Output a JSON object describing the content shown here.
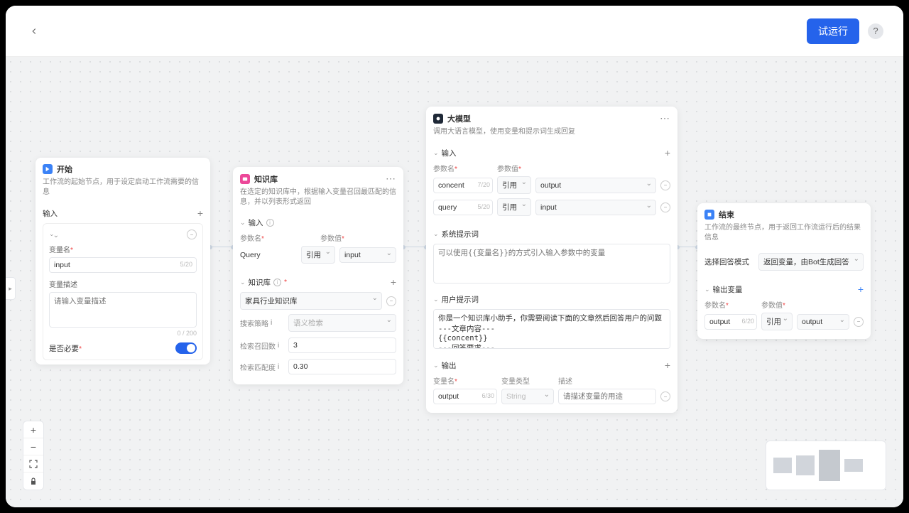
{
  "topbar": {
    "run_button": "试运行"
  },
  "node_start": {
    "title": "开始",
    "desc": "工作流的起始节点，用于设定启动工作流需要的信息",
    "input_section": "输入",
    "var_name_label": "变量名",
    "var_name_value": "input",
    "var_name_count": "5/20",
    "var_desc_label": "变量描述",
    "var_desc_placeholder": "请输入变量描述",
    "var_desc_count": "0 / 200",
    "required_label": "是否必要"
  },
  "node_kb": {
    "title": "知识库",
    "desc": "在选定的知识库中，根据输入变量召回最匹配的信息，并以列表形式返回",
    "input_section": "输入",
    "param_name_col": "参数名",
    "param_value_col": "参数值",
    "param_name": "Query",
    "ref_label": "引用",
    "ref_value": "input",
    "kb_section": "知识库",
    "kb_selected": "家具行业知识库",
    "search_strategy_label": "搜索策略",
    "search_strategy_value": "语义检索",
    "recall_count_label": "检索召回数",
    "recall_count_value": "3",
    "match_threshold_label": "检索匹配度",
    "match_threshold_value": "0.30"
  },
  "node_llm": {
    "title": "大模型",
    "desc": "调用大语言模型，使用变量和提示词生成回复",
    "input_section": "输入",
    "param_name_col": "参数名",
    "param_value_col": "参数值",
    "rows": [
      {
        "name": "concent",
        "count": "7/20",
        "ref": "引用",
        "val": "output"
      },
      {
        "name": "query",
        "count": "5/20",
        "ref": "引用",
        "val": "input"
      }
    ],
    "sys_prompt_section": "系统提示词",
    "sys_prompt_placeholder": "可以使用{{变量名}}的方式引入输入参数中的变量",
    "user_prompt_section": "用户提示词",
    "user_prompt_text": "你是一个知识库小助手，你需要阅读下面的文章然后回答用户的问题\n---文章内容---\n{{concent}}\n---回答要求---",
    "output_section": "输出",
    "out_var_name_col": "变量名",
    "out_var_type_col": "变量类型",
    "out_desc_col": "描述",
    "out_name": "output",
    "out_name_count": "6/30",
    "out_type": "String",
    "out_desc_placeholder": "请描述变量的用途"
  },
  "node_end": {
    "title": "结束",
    "desc": "工作流的最终节点，用于返回工作流运行后的结果信息",
    "answer_mode_label": "选择回答模式",
    "answer_mode_value": "返回变量，由Bot生成回答",
    "output_section": "输出变量",
    "param_name_col": "参数名",
    "param_value_col": "参数值",
    "out_name": "output",
    "out_count": "6/20",
    "ref": "引用",
    "out_val": "output"
  }
}
